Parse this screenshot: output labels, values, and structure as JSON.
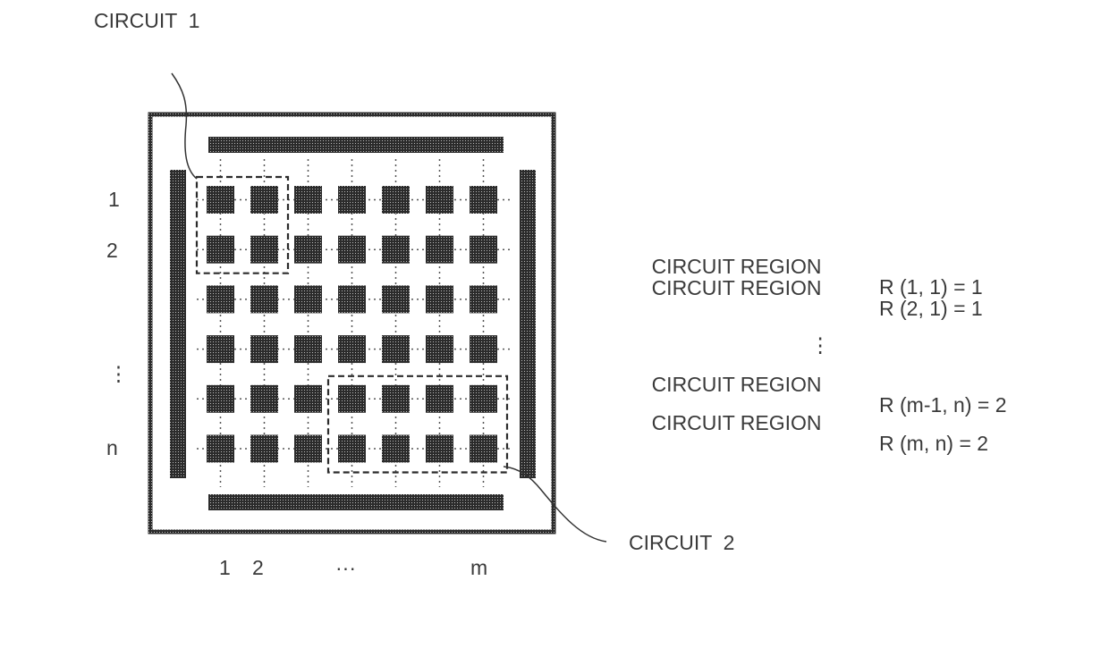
{
  "callouts": {
    "circuit1": "CIRCUIT  1",
    "circuit2": "CIRCUIT  2"
  },
  "grid": {
    "rows": 6,
    "cols": 7,
    "row_labels": [
      "1",
      "2",
      "⋮",
      "n"
    ],
    "col_labels": [
      "1",
      "2",
      "···",
      "m"
    ]
  },
  "circuit_groups": [
    {
      "name": "CIRCUIT 1",
      "rows": [
        1,
        2
      ],
      "cols": [
        1,
        2
      ]
    },
    {
      "name": "CIRCUIT 2",
      "rows": [
        5,
        6
      ],
      "cols": [
        4,
        7
      ]
    }
  ],
  "region_list": [
    {
      "label": "CIRCUIT REGION",
      "expr": "R (1, 1) = 1"
    },
    {
      "label": "CIRCUIT REGION",
      "expr": "R (2, 1) = 1"
    },
    {
      "ellipsis": "⋮"
    },
    {
      "label": "CIRCUIT REGION",
      "expr": "R (m-1, n) = 2"
    },
    {
      "label": "CIRCUIT REGION",
      "expr": "R (m, n) = 2"
    }
  ],
  "colors": {
    "fill": "#2b2b2b",
    "line": "#333333",
    "dotted": "#555555"
  }
}
